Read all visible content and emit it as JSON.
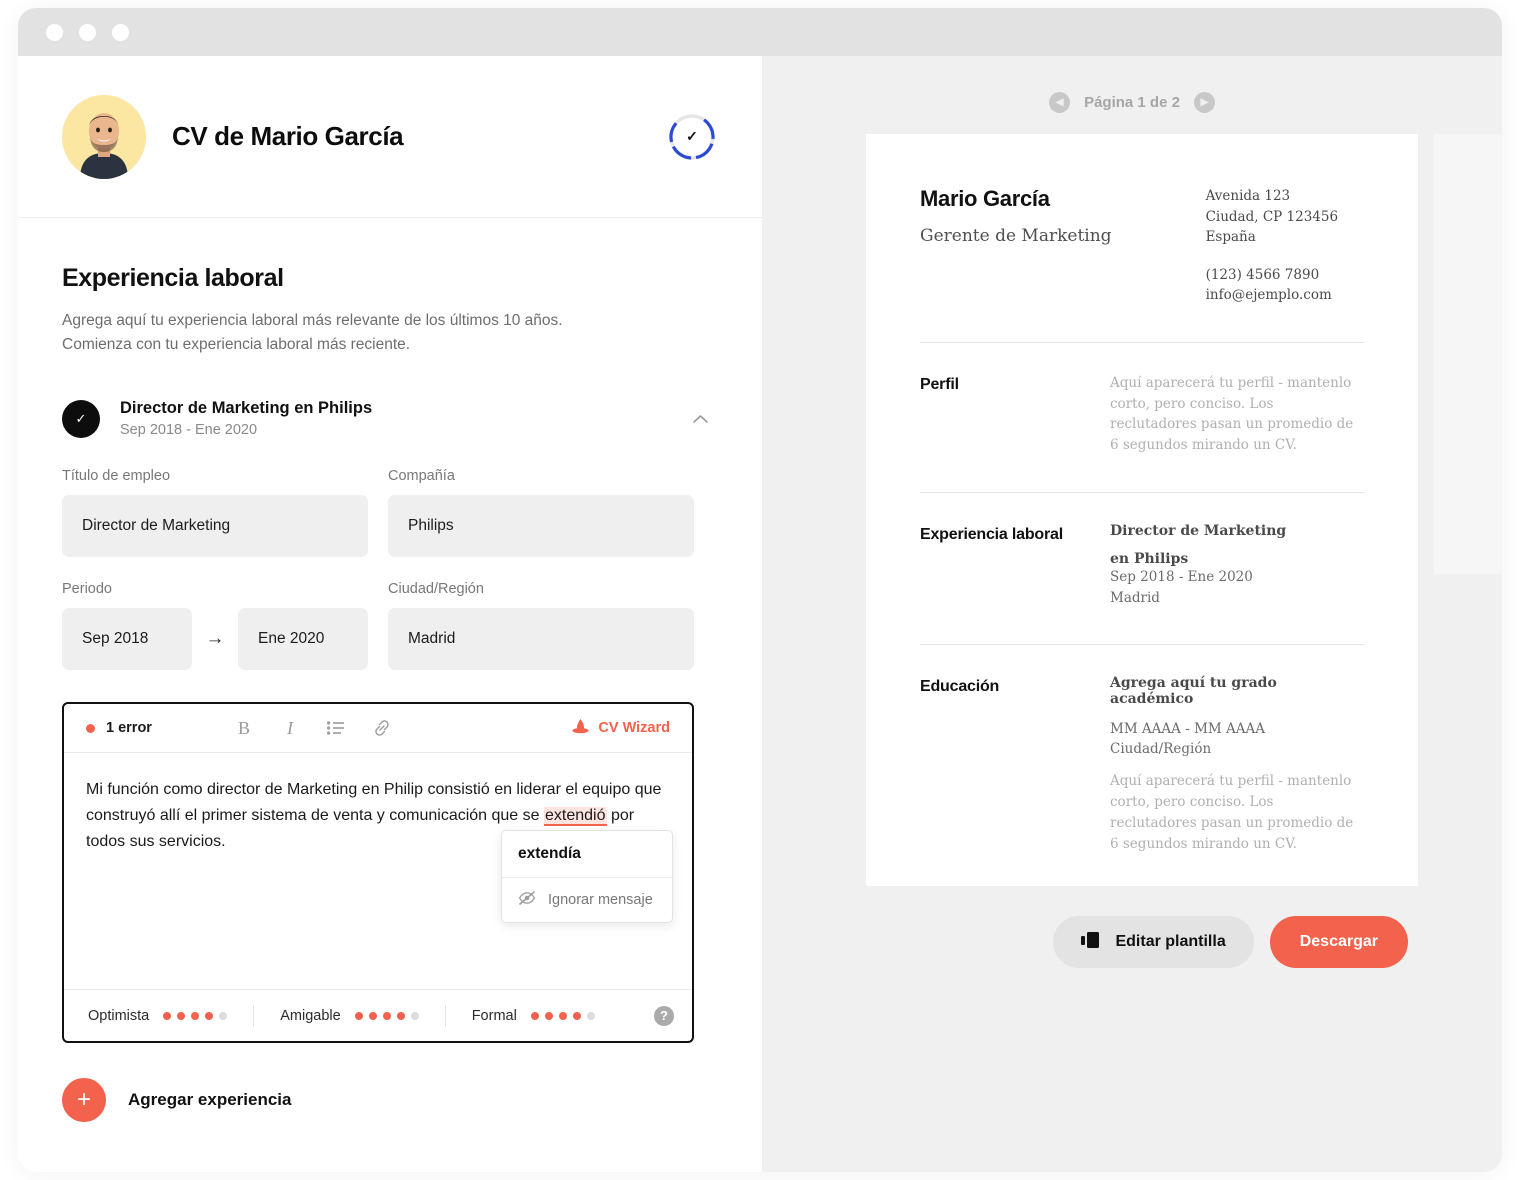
{
  "window": {
    "traffic_lights": [
      "close",
      "minimize",
      "maximize"
    ]
  },
  "editor_panel": {
    "header": {
      "avatar_alt": "Mario García",
      "title": "CV de Mario García",
      "progress_icon": "check-icon"
    },
    "section": {
      "title": "Experiencia laboral",
      "description_line1": "Agrega aquí tu experiencia laboral más relevante de los últimos 10 años.",
      "description_line2": "Comienza con tu experiencia laboral más reciente."
    },
    "experience_entry": {
      "bullet_icon": "check-icon",
      "title": "Director de Marketing en Philips",
      "subtitle": "Sep 2018 - Ene 2020",
      "collapse_icon": "chevron-up-icon"
    },
    "fields": {
      "job_title": {
        "label": "Título de empleo",
        "value": "Director de Marketing"
      },
      "company": {
        "label": "Compañía",
        "value": "Philips"
      },
      "period": {
        "label": "Periodo",
        "start": "Sep 2018",
        "end": "Ene 2020",
        "arrow": "→"
      },
      "city": {
        "label": "Ciudad/Región",
        "value": "Madrid"
      }
    },
    "rich_editor": {
      "error_count_label": "1 error",
      "tools": [
        {
          "name": "bold-icon",
          "glyph": "B"
        },
        {
          "name": "italic-icon",
          "glyph": "I"
        },
        {
          "name": "bullet-list-icon",
          "glyph": "list"
        },
        {
          "name": "link-icon",
          "glyph": "link"
        }
      ],
      "wizard_label": "CV Wizard",
      "wizard_icon": "wizard-hat-icon",
      "text_before": "Mi función como director de Marketing en Philip consistió en liderar el equipo que construyó allí el primer sistema de venta y comunicación que se ",
      "text_error": "extendió",
      "text_after": " por todos sus servicios.",
      "spellcheck": {
        "suggestion": "extendía",
        "ignore_label": "Ignorar mensaje",
        "ignore_icon": "eye-off-icon"
      },
      "tones": [
        {
          "label": "Optimista",
          "filled": 4,
          "total": 5
        },
        {
          "label": "Amigable",
          "filled": 4,
          "total": 5
        },
        {
          "label": "Formal",
          "filled": 4,
          "total": 5
        }
      ],
      "help_icon": "question-mark-icon",
      "accent_color": "#f2624c"
    },
    "add_experience": {
      "icon": "plus-icon",
      "label": "Agregar experiencia"
    }
  },
  "preview_panel": {
    "pager": {
      "prev_icon": "chevron-left-icon",
      "next_icon": "chevron-right-icon",
      "label": "Página 1 de 2"
    },
    "cv": {
      "name": "Mario García",
      "role": "Gerente de Marketing",
      "address_line1": "Avenida 123",
      "address_line2": "Ciudad, CP 123456",
      "address_line3": "España",
      "phone": "(123) 4566 7890",
      "email": "info@ejemplo.com",
      "profile": {
        "label": "Perfil",
        "placeholder": "Aquí aparecerá tu perfil - mantenlo corto, pero conciso. Los reclutadores pasan un promedio de 6 segundos mirando un CV."
      },
      "experience": {
        "label": "Experiencia laboral",
        "job_title": "Director de Marketing",
        "company": "en Philips",
        "period": "Sep 2018 - Ene 2020",
        "city": "Madrid"
      },
      "education": {
        "label": "Educación",
        "degree_placeholder": "Agrega aquí tu grado académico",
        "period_placeholder": "MM AAAA - MM AAAA",
        "city_placeholder": "Ciudad/Región",
        "description_placeholder": "Aquí aparecerá tu perfil - mantenlo corto, pero conciso. Los reclutadores pasan un promedio de 6 segundos mirando un CV."
      }
    },
    "actions": {
      "edit_template_label": "Editar plantilla",
      "edit_template_icon": "template-icon",
      "download_label": "Descargar",
      "download_color": "#f2624c"
    }
  }
}
